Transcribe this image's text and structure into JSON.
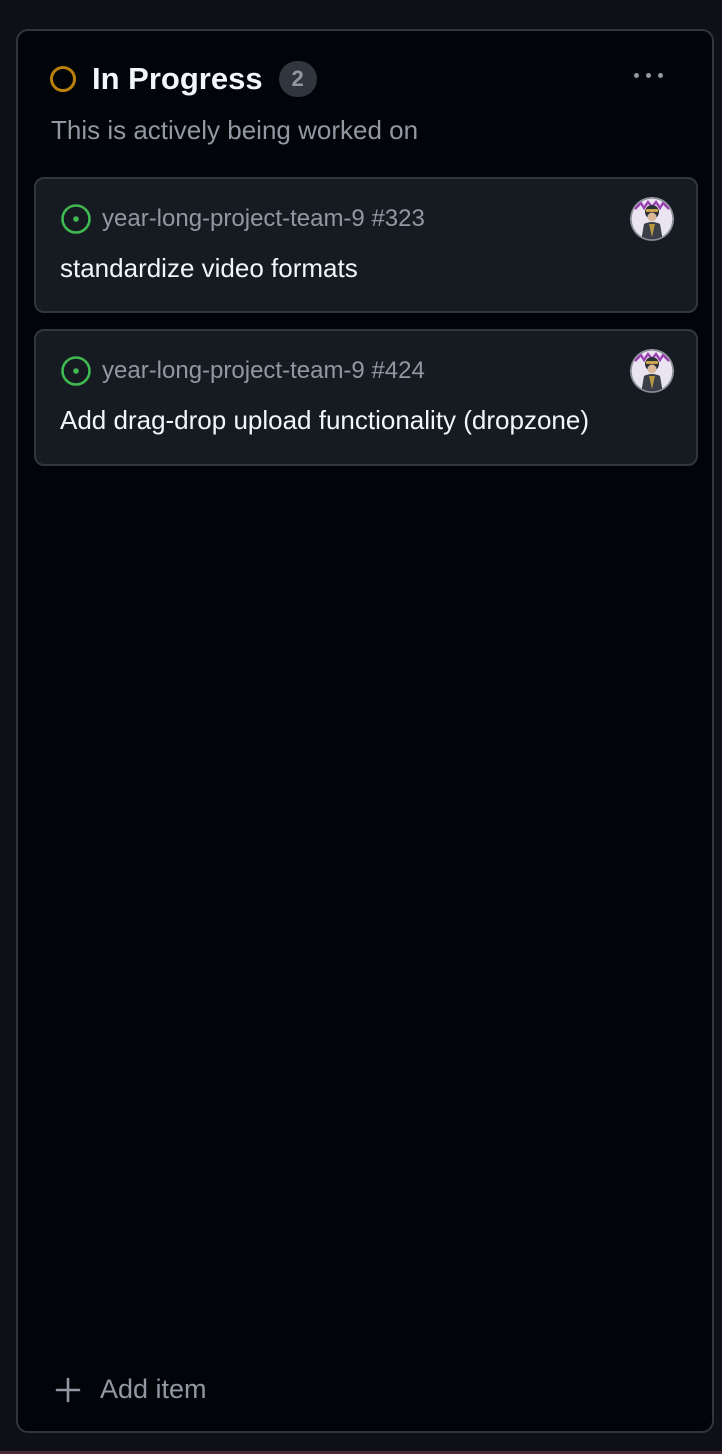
{
  "column": {
    "title": "In Progress",
    "count": "2",
    "description": "This is actively being worked on",
    "status_color": "#bb8009",
    "more_icon": "kebab-horizontal-icon"
  },
  "cards": [
    {
      "repo_ref": "year-long-project-team-9 #323",
      "title": "standardize video formats",
      "icon": "issue-opened-icon",
      "icon_color": "#3fb950"
    },
    {
      "repo_ref": "year-long-project-team-9 #424",
      "title": "Add drag-drop upload functionality (dropzone)",
      "icon": "issue-opened-icon",
      "icon_color": "#3fb950"
    }
  ],
  "footer": {
    "add_label": "Add item",
    "add_icon": "plus-icon"
  },
  "colors": {
    "page_background": "#0d1117",
    "column_background": "#010409",
    "card_background": "#161b22",
    "border": "#30363d",
    "text_primary": "#f0f6fc",
    "text_muted": "#9198a1"
  }
}
